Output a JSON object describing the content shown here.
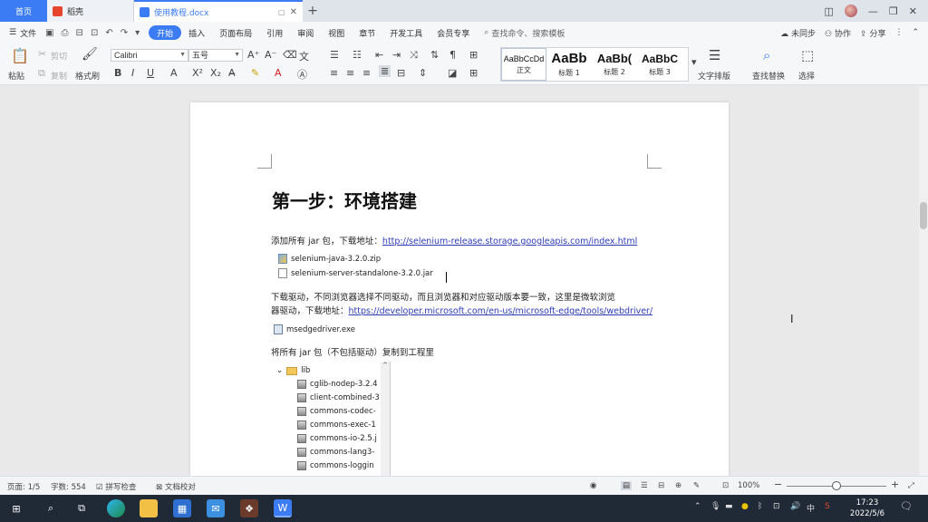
{
  "tabs": {
    "home": "首页",
    "tab1": "稻壳",
    "tab2": "使用教程.docx"
  },
  "menu": {
    "file": "文件",
    "items": [
      "开始",
      "插入",
      "页面布局",
      "引用",
      "审阅",
      "视图",
      "章节",
      "开发工具",
      "会员专享"
    ],
    "search": "查找命令、搜索模板",
    "right": [
      "未同步",
      "协作",
      "分享"
    ]
  },
  "toolbar": {
    "paste": "粘贴",
    "cut": "剪切",
    "copy": "复制",
    "format_painter": "格式刷",
    "font_name": "Calibri",
    "font_size": "五号",
    "styles": [
      {
        "sample": "AaBbCcDd",
        "label": "正文"
      },
      {
        "sample": "AaBb",
        "label": "标题 1"
      },
      {
        "sample": "AaBb(",
        "label": "标题 2"
      },
      {
        "sample": "AaBbC",
        "label": "标题 3"
      }
    ],
    "text_layout": "文字排版",
    "find_replace": "查找替换",
    "select": "选择"
  },
  "document": {
    "title": "第一步：环境搭建",
    "p1_text": "添加所有 jar 包，下载地址：",
    "p1_link": "http://selenium-release.storage.googleapis.com/index.html",
    "files1": [
      "selenium-java-3.2.0.zip",
      "selenium-server-standalone-3.2.0.jar"
    ],
    "p2_line1": "下载驱动，不同浏览器选择不同驱动，而且浏览器和对应驱动版本要一致，这里是微软浏览",
    "p2_line2": "器驱动，下载地址：",
    "p2_link": "https://developer.microsoft.com/en-us/microsoft-edge/tools/webdriver/",
    "driver_file": "msedgedriver.exe",
    "p3_text": "将所有 jar 包（不包括驱动）复制到工程里",
    "tree_folder": "lib",
    "tree_items": [
      "cglib-nodep-3.2.4",
      "client-combined-3",
      "commons-codec-",
      "commons-exec-1",
      "commons-io-2.5.j",
      "commons-lang3-",
      "commons-loggin"
    ]
  },
  "status": {
    "page": "页面: 1/5",
    "words": "字数: 554",
    "spell": "拼写检查",
    "doc_check": "文档校对",
    "zoom": "100%"
  },
  "taskbar": {
    "time": "17:23",
    "date": "2022/5/6",
    "ime": "中"
  }
}
